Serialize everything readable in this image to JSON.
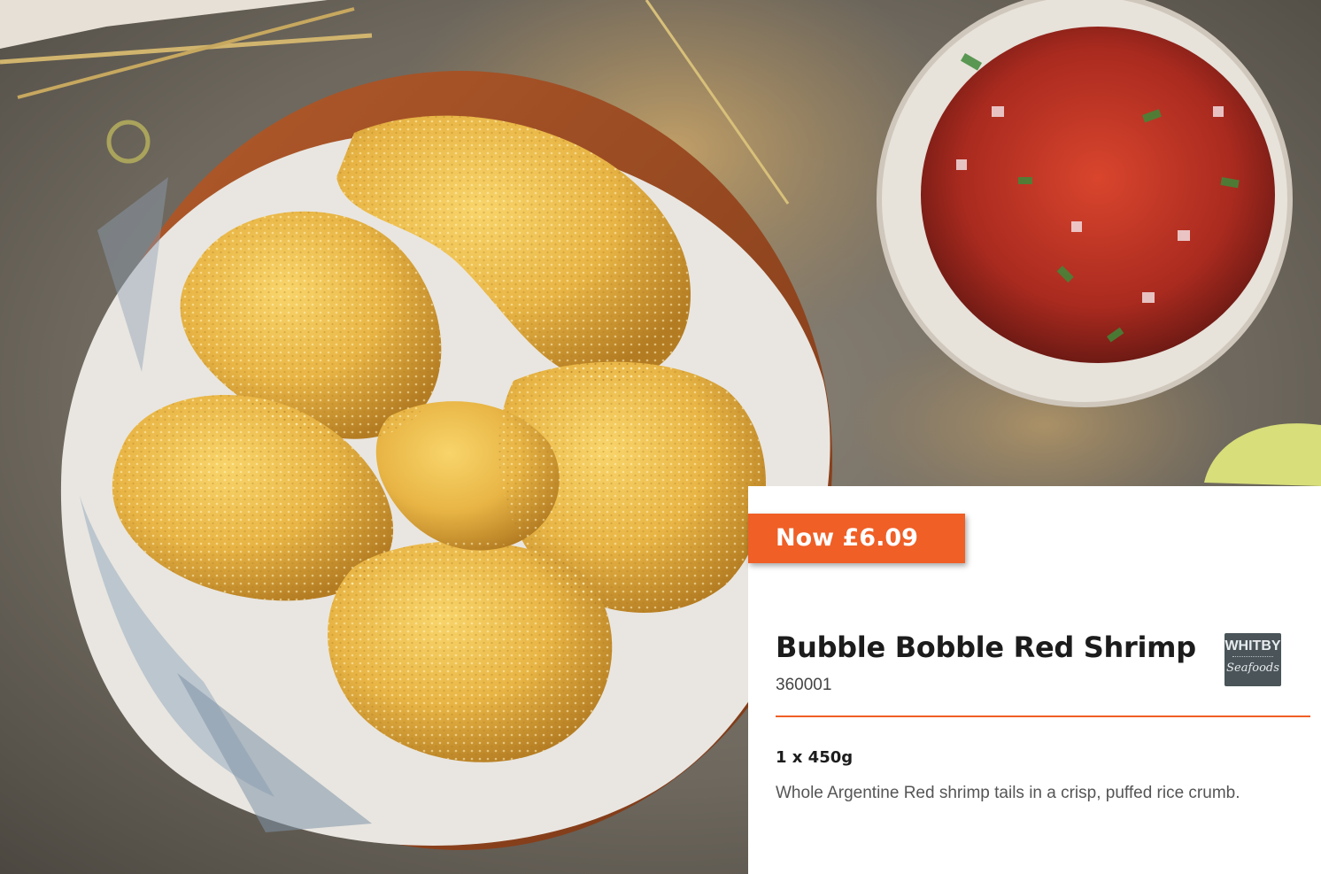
{
  "product": {
    "price_label": "Now £6.09",
    "name": "Bubble Bobble Red Shrimp",
    "code": "360001",
    "pack_size": "1 x 450g",
    "description": "Whole Argentine Red shrimp tails in a crisp, puffed rice crumb."
  },
  "brand_logo": {
    "line1": "WHITBY",
    "line2": "Seafoods"
  },
  "photo": {
    "subject": "bowl of breaded shrimp with a bowl of salsa"
  },
  "colors": {
    "accent": "#ef5f26",
    "text": "#1c1c1c",
    "muted": "#555555",
    "logo_bg": "#4a5459"
  }
}
